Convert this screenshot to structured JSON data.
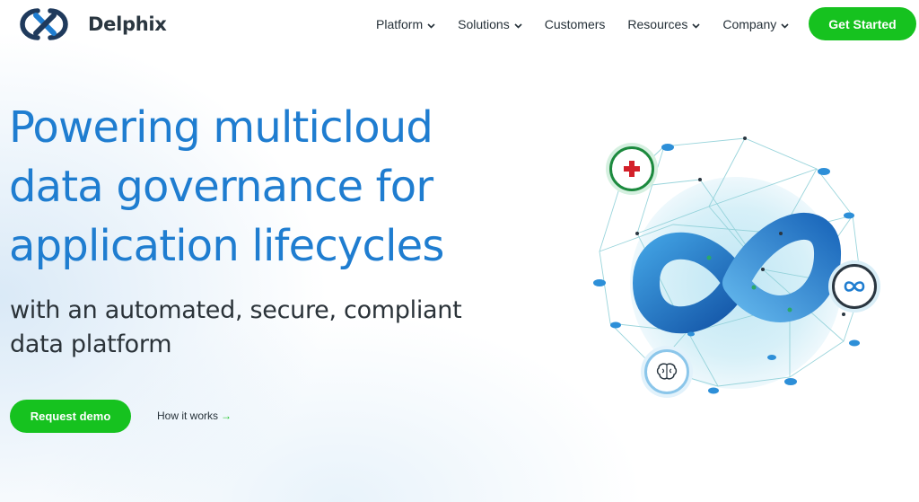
{
  "brand": {
    "name": "Delphix"
  },
  "nav": {
    "items": [
      {
        "label": "Platform",
        "has_dropdown": true
      },
      {
        "label": "Solutions",
        "has_dropdown": true
      },
      {
        "label": "Customers",
        "has_dropdown": false
      },
      {
        "label": "Resources",
        "has_dropdown": true
      },
      {
        "label": "Company",
        "has_dropdown": true
      }
    ],
    "cta_label": "Get Started"
  },
  "hero": {
    "title_lines": [
      "Powering multicloud",
      "data governance for",
      "application lifecycles"
    ],
    "subtitle_lines": [
      "with an automated, secure, compliant",
      "data platform"
    ],
    "primary_button": "Request demo",
    "secondary_link": "How it works",
    "secondary_link_icon": "arrow-right-icon"
  },
  "graphic": {
    "badges": [
      "medical-cross-icon",
      "infinity-icon",
      "brain-icon"
    ]
  },
  "colors": {
    "accent_green": "#16c21f",
    "brand_blue": "#1f7dd0",
    "text_dark": "#263139"
  }
}
